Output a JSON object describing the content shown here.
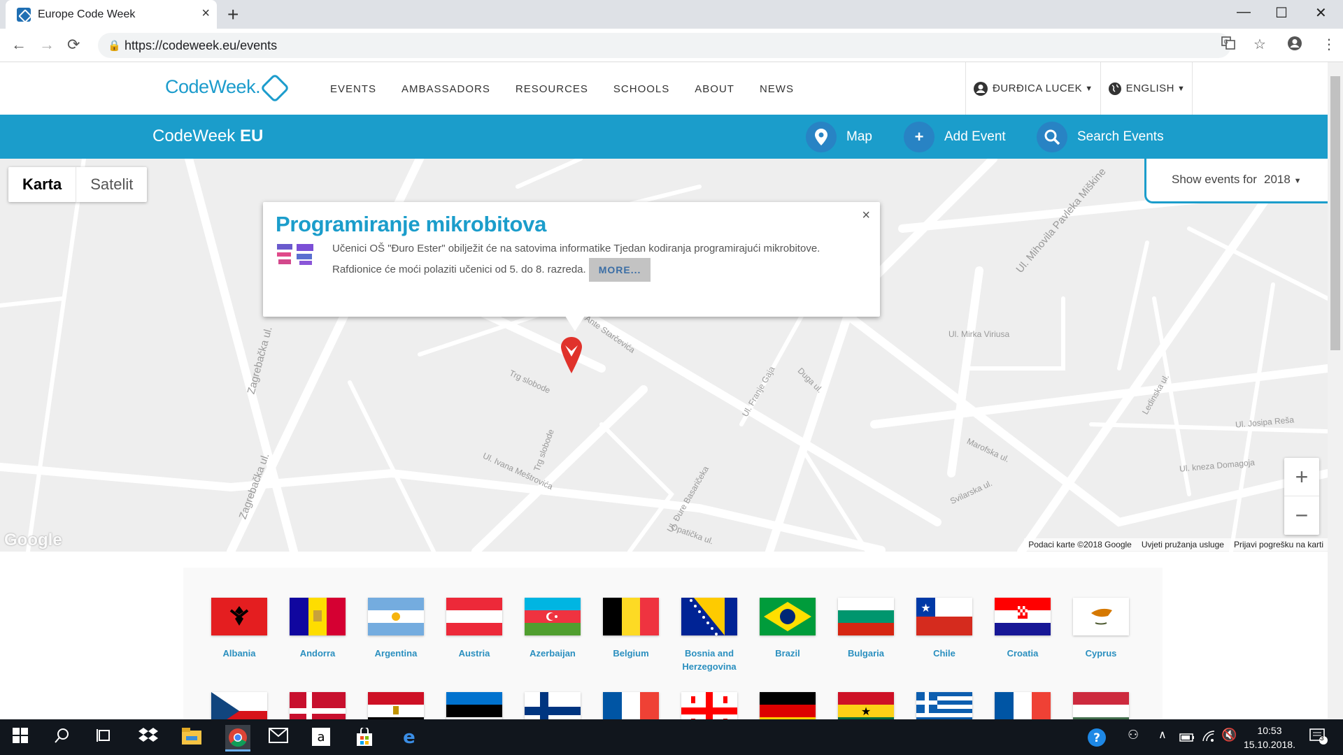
{
  "browser": {
    "tab_title": "Europe Code Week",
    "tab_close": "×",
    "new_tab": "+",
    "url": "https://codeweek.eu/events",
    "back": "←",
    "forward": "→",
    "reload": "⟳",
    "star": "☆",
    "menu": "⋮",
    "minimize": "—",
    "maximize": "☐",
    "close": "✕"
  },
  "site": {
    "logo_text": "CodeWeek.",
    "nav": [
      "EVENTS",
      "AMBASSADORS",
      "RESOURCES",
      "SCHOOLS",
      "ABOUT",
      "NEWS"
    ],
    "user_name": "ĐURĐICA LUCEK",
    "language": "ENGLISH",
    "brand_light": "CodeWeek ",
    "brand_bold": "EU",
    "actions": {
      "map": "Map",
      "add_event": "Add Event",
      "search_events": "Search Events"
    }
  },
  "map": {
    "type_active": "Karta",
    "type_inactive": "Satelit",
    "show_events_label": "Show events for",
    "show_events_year": "2018",
    "zoom_in": "+",
    "zoom_out": "−",
    "google": "Google",
    "footer": [
      "Podaci karte ©2018 Google",
      "Uvjeti pružanja usluge",
      "Prijavi pogrešku na karti"
    ],
    "infowindow": {
      "title": "Programiranje mikrobitova",
      "description": "Učenici OŠ \"Đuro Ester\" obilježit će na satovima informatike Tjedan kodiranja programirajući mikrobitove. Rafdionice će moći polaziti učenici od 5. do 8. razreda.",
      "more_label": "MORE...",
      "close": "×"
    },
    "street_labels": [
      "Zagrebačka ul.",
      "Zagrebačka ul.",
      "Trg slobode",
      "Ul. Ivana Meštrovića",
      "Ul. Mihovila Pavleka Miškine",
      "Ul. Mirka Viriusa",
      "Ul. Josipa Reša",
      "Ul. kneza Domagoja",
      "Svilarska ul.",
      "Ul. Franje Gaja",
      "Duga ul.",
      "Ul. Đure Basaričeka",
      "Opatička ul.",
      "Trg slobode",
      "Ante Starčevića",
      "Ledinska ul.",
      "Marofska ul."
    ]
  },
  "countries": [
    {
      "name": "Albania"
    },
    {
      "name": "Andorra"
    },
    {
      "name": "Argentina"
    },
    {
      "name": "Austria"
    },
    {
      "name": "Azerbaijan"
    },
    {
      "name": "Belgium"
    },
    {
      "name": "Bosnia and Herzegovina"
    },
    {
      "name": "Brazil"
    },
    {
      "name": "Bulgaria"
    },
    {
      "name": "Chile"
    },
    {
      "name": "Croatia"
    },
    {
      "name": "Cyprus"
    }
  ],
  "taskbar": {
    "time": "10:53",
    "date": "15.10.2018.",
    "notifications": "3"
  }
}
